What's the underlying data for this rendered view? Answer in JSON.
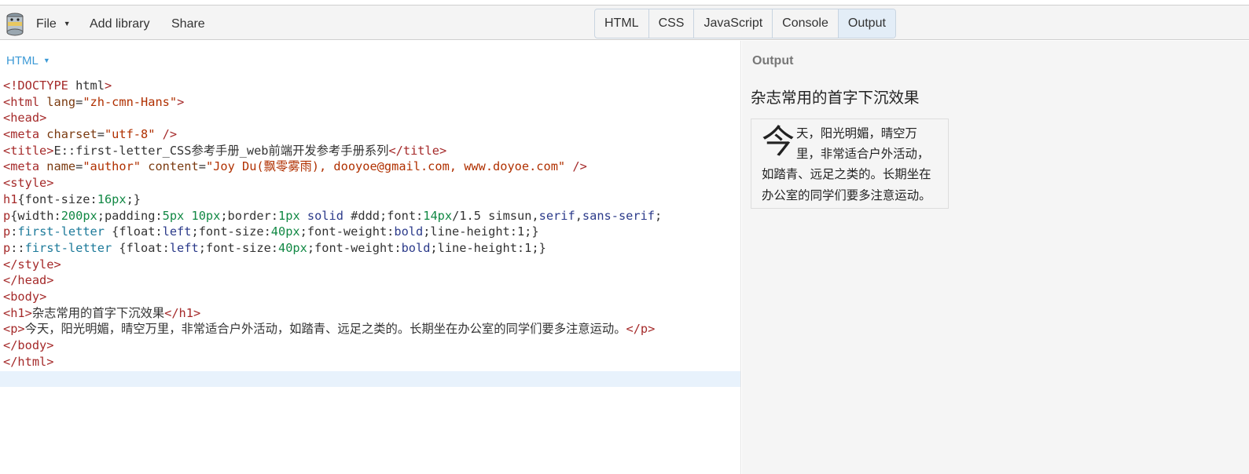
{
  "toolbar": {
    "file_label": "File",
    "add_library_label": "Add library",
    "share_label": "Share"
  },
  "tabs": [
    {
      "label": "HTML",
      "active": false
    },
    {
      "label": "CSS",
      "active": false
    },
    {
      "label": "JavaScript",
      "active": false
    },
    {
      "label": "Console",
      "active": false
    },
    {
      "label": "Output",
      "active": true
    }
  ],
  "editor": {
    "mode_label": "HTML",
    "lines": [
      "<!DOCTYPE html>",
      "<html lang=\"zh-cmn-Hans\">",
      "<head>",
      "<meta charset=\"utf-8\" />",
      "<title>E::first-letter_CSS参考手册_web前端开发参考手册系列</title>",
      "<meta name=\"author\" content=\"Joy Du(飘零雾雨), dooyoe@gmail.com, www.doyoe.com\" />",
      "<style>",
      "h1{font-size:16px;}",
      "p{width:200px;padding:5px 10px;border:1px solid #ddd;font:14px/1.5 simsun,serif,sans-serif;",
      "p:first-letter {float:left;font-size:40px;font-weight:bold;line-height:1;}",
      "p::first-letter {float:left;font-size:40px;font-weight:bold;line-height:1;}",
      "</style>",
      "</head>",
      "<body>",
      "<h1>杂志常用的首字下沉效果</h1>",
      "<p>今天，阳光明媚，晴空万里，非常适合户外活动，如踏青、远足之类的。长期坐在办公室的同学们要多注意运动。</p>",
      "</body>",
      "</html>"
    ]
  },
  "output": {
    "label": "Output",
    "heading": "杂志常用的首字下沉效果",
    "first_letter": "今",
    "paragraph_rest": "天，阳光明媚，晴空万里，非常适合户外活动，如踏青、远足之类的。长期坐在办公室的同学们要多注意运动。"
  },
  "colors": {
    "accent": "#3d9ad6",
    "active_tab": "#e3edf7",
    "current_line": "#e8f2fc"
  }
}
